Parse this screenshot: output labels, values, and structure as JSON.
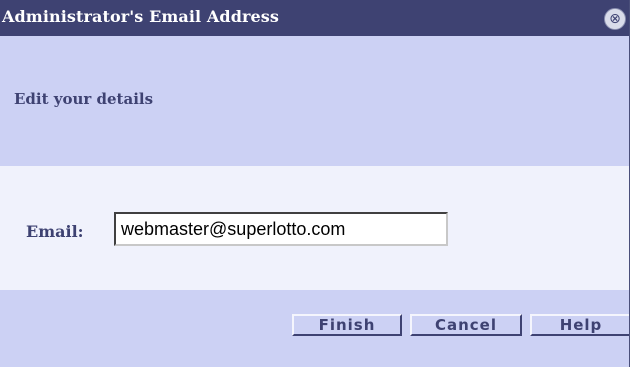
{
  "window": {
    "title": "Administrator's Email Address",
    "close_glyph": "⊗"
  },
  "header": {
    "text": "Edit your details"
  },
  "form": {
    "email_label": "Email:",
    "email_value": "webmaster@superlotto.com"
  },
  "buttons": {
    "finish": "Finish",
    "cancel": "Cancel",
    "help": "Help"
  },
  "colors": {
    "titlebar": "#3e4272",
    "panel": "#ccd1f4",
    "content": "#f0f2fc",
    "text": "#3e4272"
  }
}
